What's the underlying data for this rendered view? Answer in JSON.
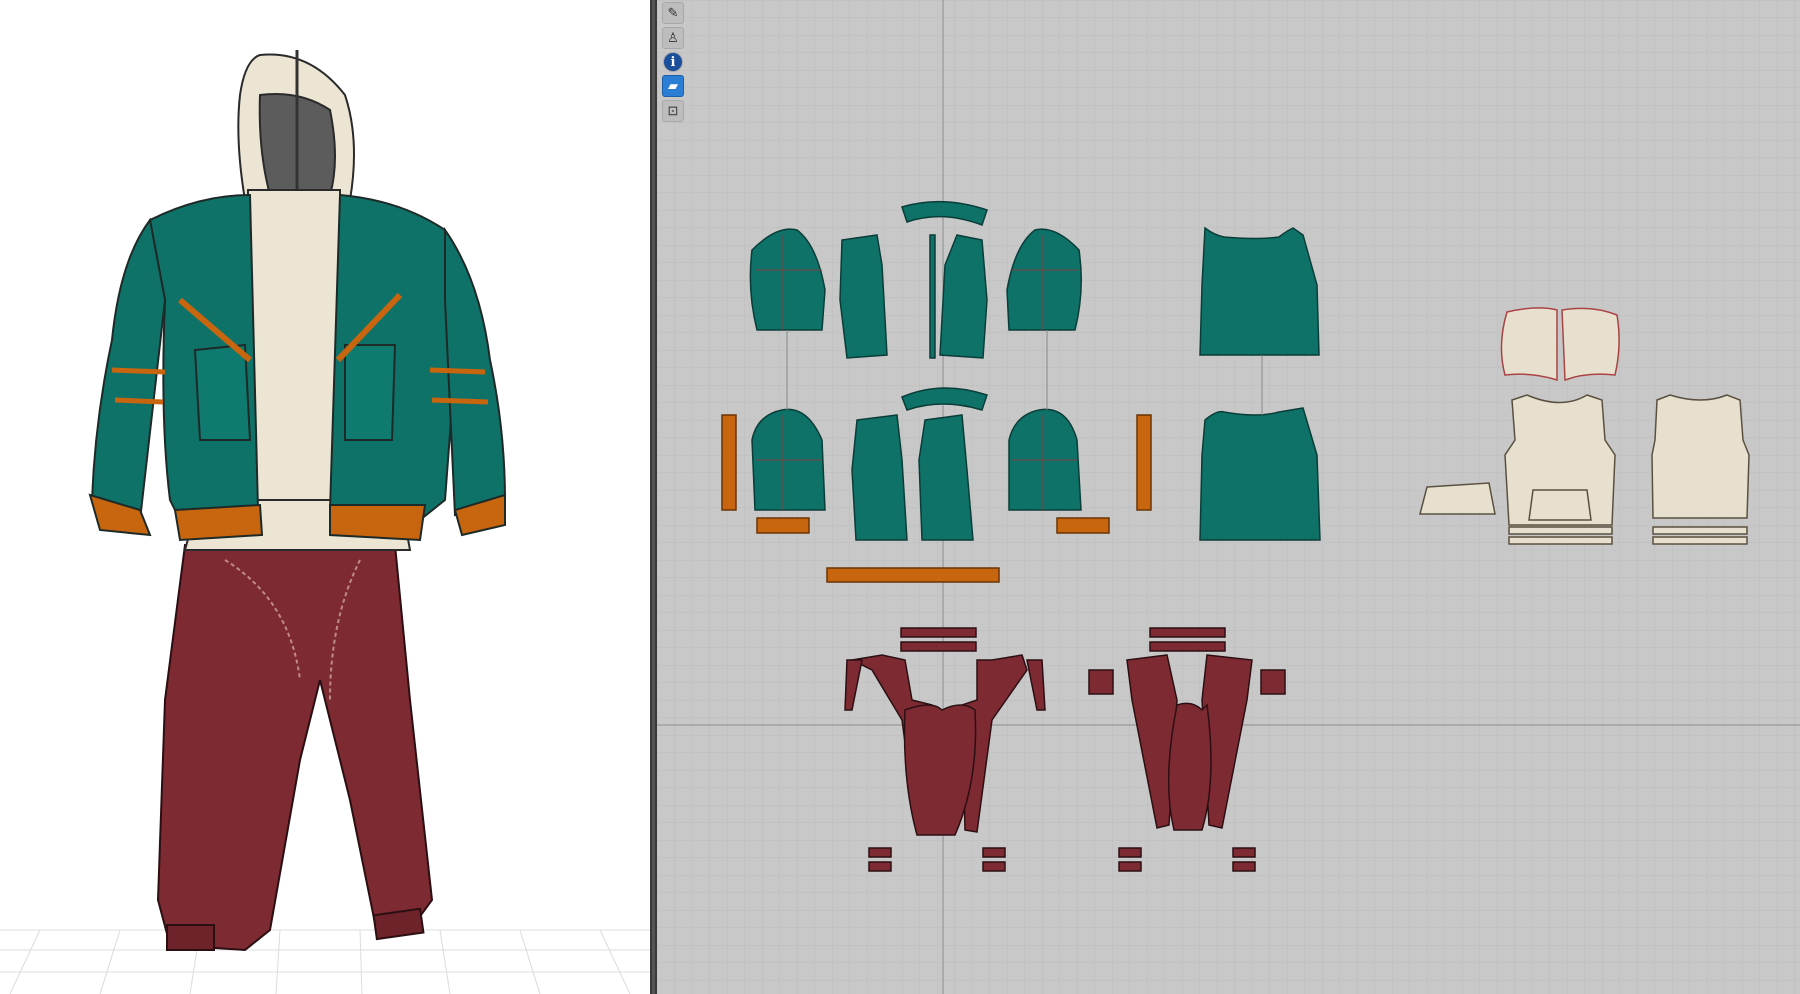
{
  "colors": {
    "jacket_teal": "#0e7268",
    "trim_orange": "#c8650f",
    "hoodie_cream": "#e8e0cf",
    "pants_maroon": "#7e2a33",
    "pattern_bg": "#c8c8c8",
    "grid_line": "#b8b8b8",
    "accent_blue": "#2a7fd4"
  },
  "avatar_view": {
    "garments": [
      "hoodie",
      "bomber-jacket",
      "jogger-pants"
    ]
  },
  "toolbar": {
    "tools": [
      {
        "icon": "pen-icon",
        "glyph": "✎"
      },
      {
        "icon": "shirt-icon",
        "glyph": "♙"
      },
      {
        "icon": "info-icon",
        "glyph": "i"
      },
      {
        "icon": "fabric-icon",
        "glyph": "▰"
      },
      {
        "icon": "lock-shirt-icon",
        "glyph": "⊡"
      }
    ]
  }
}
